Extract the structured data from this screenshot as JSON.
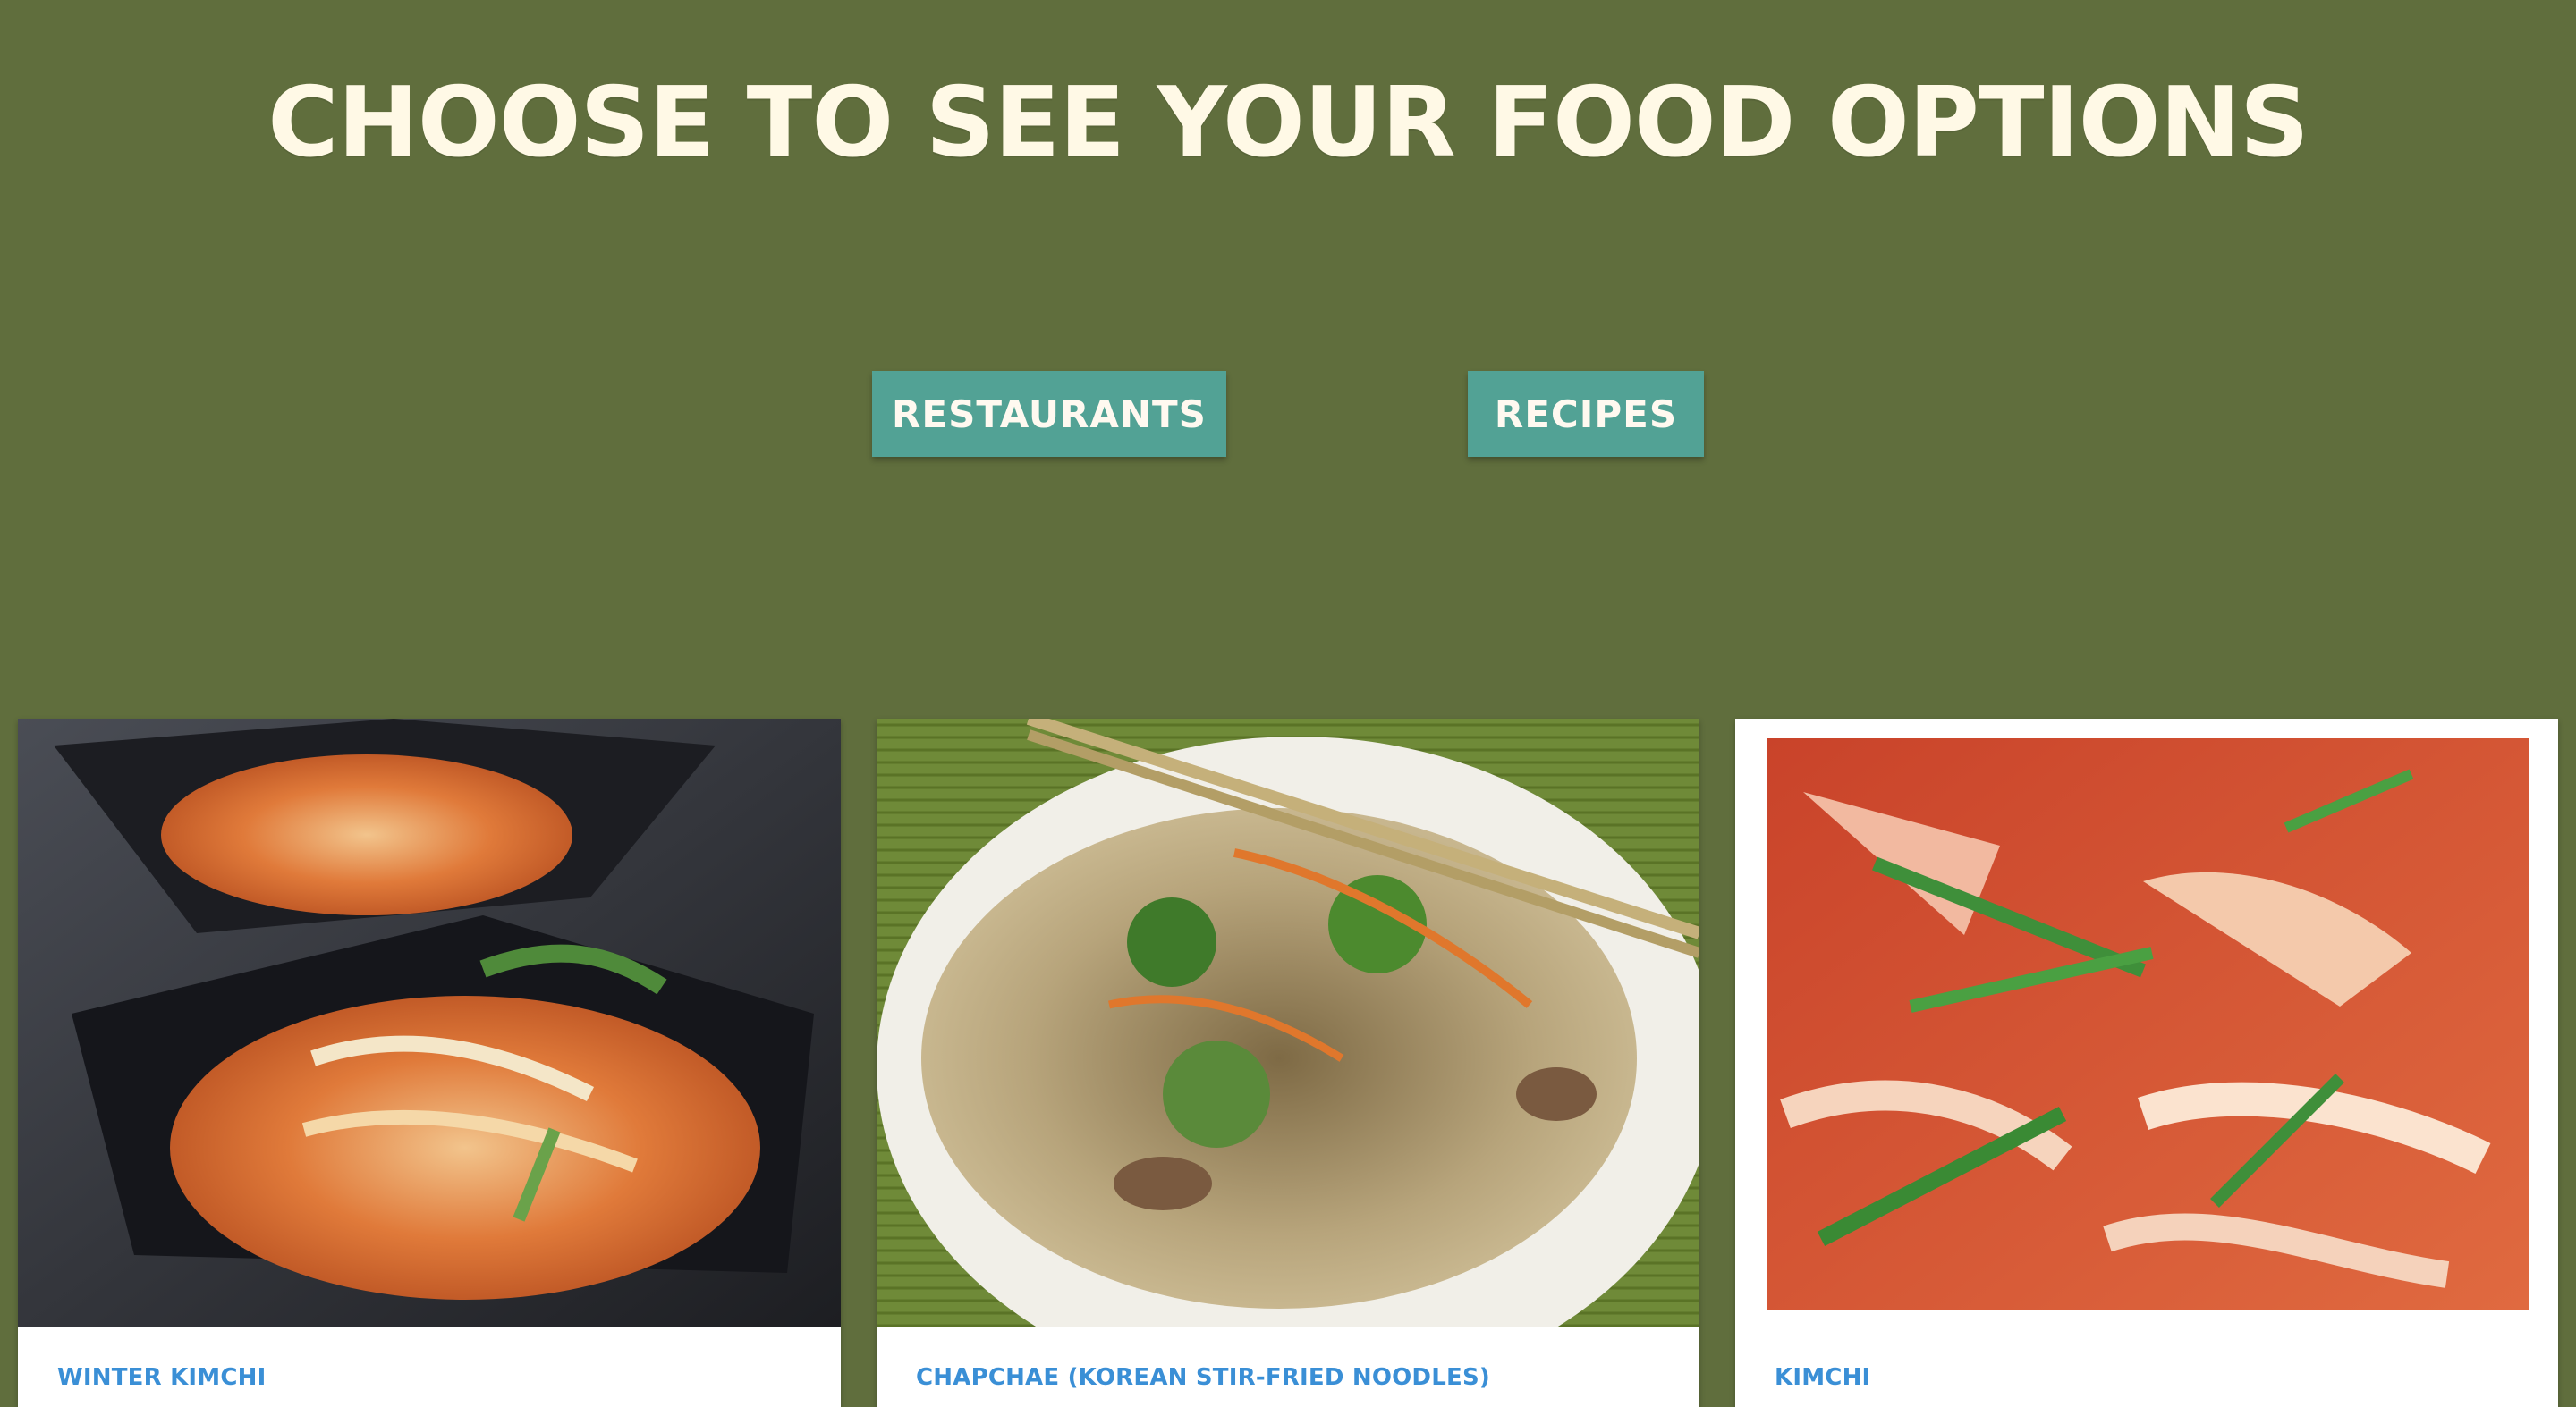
{
  "header": {
    "title": "Choose to see your food options"
  },
  "options": {
    "restaurants_label": "Restaurants",
    "recipes_label": "Recipes"
  },
  "recipes": [
    {
      "title": "Winter Kimchi",
      "image": "winter-kimchi-photo"
    },
    {
      "title": "Chapchae (Korean Stir-Fried Noodles)",
      "image": "chapchae-photo"
    },
    {
      "title": "Kimchi",
      "image": "kimchi-photo"
    }
  ],
  "colors": {
    "background": "#606e3d",
    "title": "#fff9e6",
    "button": "#52a295",
    "card_title": "#3a8fd6"
  }
}
